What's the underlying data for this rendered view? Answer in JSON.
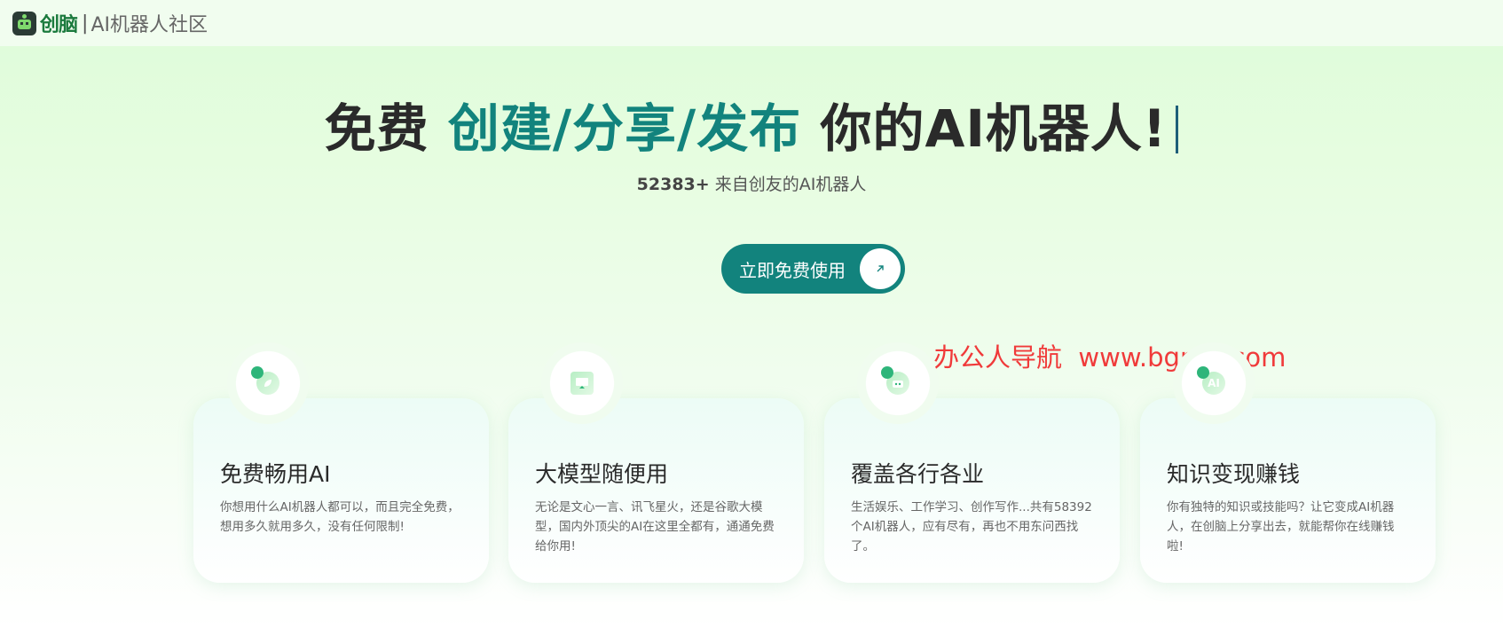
{
  "header": {
    "brand_name": "创脑",
    "separator": "|",
    "brand_tagline": "AI机器人社区"
  },
  "hero": {
    "title_prefix": "免费",
    "title_accent": "创建/分享/发布",
    "title_suffix": "你的AI机器人!",
    "count": "52383+",
    "subtitle": "来自创友的AI机器人",
    "cta_label": "立即免费使用",
    "cta_icon": "arrow-up-right-icon"
  },
  "watermark": "办公人导航  www.bgrdh.com",
  "colors": {
    "accent": "#12837d",
    "watermark": "#f03a3a"
  },
  "features": [
    {
      "icon": "leaf-icon",
      "title": "免费畅用AI",
      "description": "你想用什么AI机器人都可以，而且完全免费，想用多久就用多久，没有任何限制!"
    },
    {
      "icon": "monitor-icon",
      "title": "大模型随便用",
      "description": "无论是文心一言、讯飞星火，还是谷歌大模型，国内外顶尖的AI在这里全都有，通通免费给你用!"
    },
    {
      "icon": "robot-icon",
      "title": "覆盖各行各业",
      "description": "生活娱乐、工作学习、创作写作...共有58392个AI机器人，应有尽有，再也不用东问西找了。"
    },
    {
      "icon": "ai-chip-icon",
      "badge_text": "AI",
      "title": "知识变现赚钱",
      "description": "你有独特的知识或技能吗？让它变成AI机器人，在创脑上分享出去，就能帮你在线赚钱啦!"
    }
  ]
}
